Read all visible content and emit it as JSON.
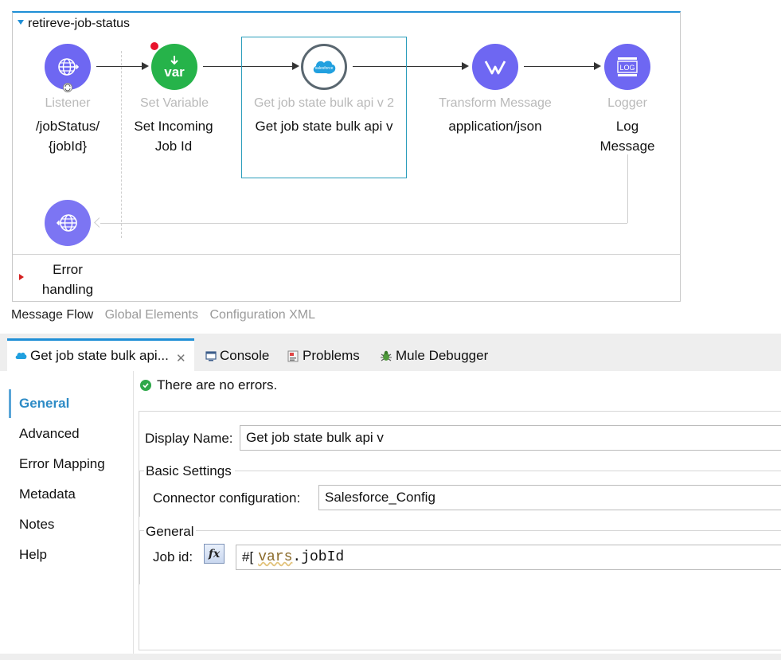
{
  "flow": {
    "name": "retireve-job-status",
    "nodes": [
      {
        "type": "Listener",
        "label": "/jobStatus/ {jobId}"
      },
      {
        "type": "Set Variable",
        "label": "Set Incoming Job Id",
        "icon_text": "var"
      },
      {
        "type": "Get job state bulk api v 2",
        "label": "Get job state bulk api v",
        "icon_text": "salesforce"
      },
      {
        "type": "Transform Message",
        "label": "application/json"
      },
      {
        "type": "Logger",
        "label": "Log Message",
        "icon_text": "LOG"
      }
    ],
    "error_handling": "Error handling"
  },
  "editor_tabs": {
    "message_flow": "Message Flow",
    "global_elements": "Global Elements",
    "configuration_xml": "Configuration XML"
  },
  "panel_tabs": {
    "active": "Get job state bulk api...",
    "console": "Console",
    "problems": "Problems",
    "mule_debugger": "Mule Debugger"
  },
  "nav": {
    "items": [
      "General",
      "Advanced",
      "Error Mapping",
      "Metadata",
      "Notes",
      "Help"
    ],
    "selected": "General"
  },
  "form": {
    "status": "There are no errors.",
    "display_name_label": "Display Name:",
    "display_name_value": "Get job state bulk api v",
    "basic_settings_title": "Basic Settings",
    "connector_config_label": "Connector configuration:",
    "connector_config_value": "Salesforce_Config",
    "general_title": "General",
    "job_id_label": "Job id:",
    "fx_label": "fx",
    "expr_prefix": "#[",
    "expr_var": "vars",
    "expr_rest": ".jobId"
  },
  "colors": {
    "accent": "#1f8fd6",
    "node_purple": "#6e67f2",
    "node_green": "#26b34a",
    "error_red": "#d42020"
  }
}
